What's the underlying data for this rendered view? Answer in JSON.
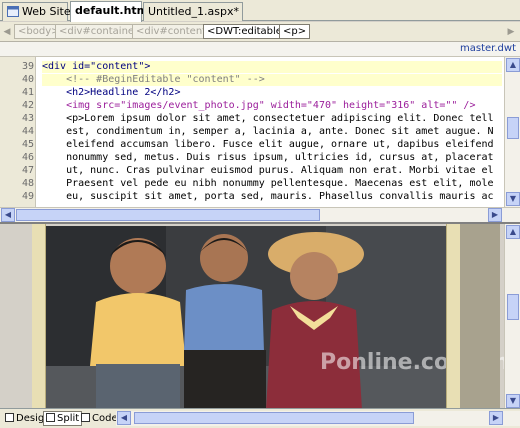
{
  "tabs": [
    {
      "label": "Web Site",
      "icon": "website-icon"
    },
    {
      "label": "default.htm",
      "icon": "html-file-icon"
    },
    {
      "label": "Untitled_1.aspx*",
      "icon": "none"
    }
  ],
  "breadcrumb": {
    "items": [
      "<body>",
      "<div#container>",
      "<div#content>",
      "<DWT:editable>",
      "<p>"
    ]
  },
  "master_link": "master.dwt",
  "code": {
    "line_numbers": [
      "39",
      "40",
      "41",
      "42",
      "43",
      "44",
      "45",
      "46",
      "47",
      "48",
      "49"
    ],
    "lines": [
      "<div id=\"content\">",
      "    <!-- #BeginEditable \"content\" -->",
      "    <h2>Headline 2</h2>",
      "    <img src=\"images/event_photo.jpg\" width=\"470\" height=\"316\" alt=\"\" />",
      "    <p>Lorem ipsum dolor sit amet, consectetuer adipiscing elit. Donec tell",
      "    est, condimentum in, semper a, lacinia a, ante. Donec sit amet augue. N",
      "    eleifend accumsan libero. Fusce elit augue, ornare ut, dapibus eleifend",
      "    nonummy sed, metus. Duis risus ipsum, ultricies id, cursus at, placerat",
      "    ut, nunc. Cras pulvinar euismod purus. Aliquam non erat. Morbi vitae el",
      "    Praesent vel pede eu nibh nonummy pellentesque. Maecenas est elit, mole",
      "    eu, suscipit sit amet, porta sed, mauris. Phasellus convallis mauris ac"
    ]
  },
  "design_view": {
    "watermark": "Ponline.com.cn"
  },
  "view_buttons": {
    "design": "Design",
    "split": "Split",
    "code": "Code"
  },
  "colors": {
    "tag": "#000080",
    "attribute": "#9b1e9b",
    "value": "#0000ff",
    "comment": "#808080",
    "highlight": "#ffffcc"
  }
}
